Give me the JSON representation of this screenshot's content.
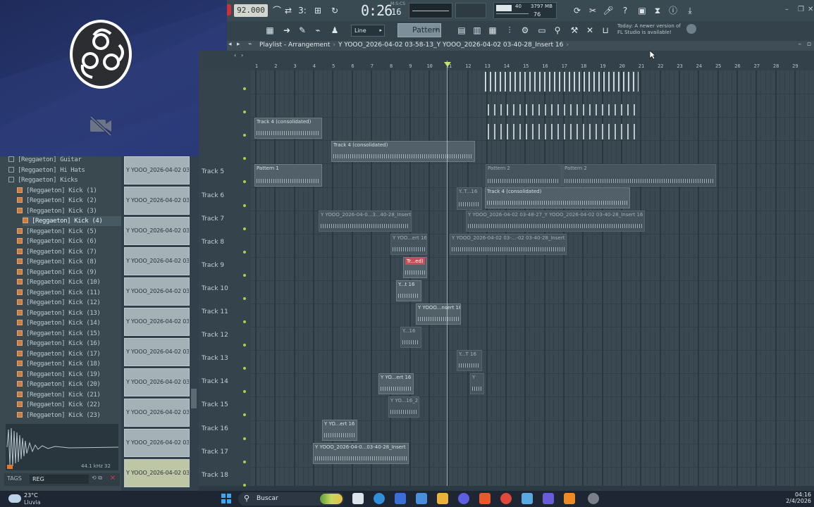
{
  "toolbar": {
    "tempo": "92.000",
    "time": "0:26",
    "time_frac": "16",
    "time_unit": "M:S:CS",
    "cpu_cores": "40",
    "memory": "3797 MB",
    "polyphony": "76",
    "snap_mode": "Line",
    "pattern": "Pattern 1",
    "news_line1": "Today: A newer version of",
    "news_line2": "FL Studio is available!"
  },
  "playlist": {
    "title": "Playlist - Arrangement",
    "path": "Y YOOO_2026-04-02 03-58-13_Y YOOO_2026-04-02 03-40-28_Insert 16",
    "ruler": [
      "1",
      "2",
      "3",
      "4",
      "5",
      "6",
      "7",
      "8",
      "9",
      "10",
      "11",
      "12",
      "13",
      "14",
      "15",
      "16",
      "17",
      "18",
      "19",
      "20",
      "21",
      "22",
      "23",
      "24",
      "25",
      "26",
      "27",
      "28",
      "29"
    ],
    "tracks": [
      "",
      "",
      "",
      "",
      "Track 5",
      "Track 6",
      "Track 7",
      "Track 8",
      "Track 9",
      "Track 10",
      "Track 11",
      "Track 12",
      "Track 13",
      "Track 14",
      "Track 15",
      "Track 16",
      "Track 17",
      "Track 18"
    ],
    "clips": {
      "c1": "Track 4 (consolidated)",
      "c2": "Track 4 (consolidated)",
      "c3": "Pattern 1",
      "c4": "Pattern 2",
      "c5": "Pattern 2",
      "c6": "Y..T...16",
      "c7": "Track 4 (consolidated)",
      "c8": "Y YOOO_2026-04-0...3...40-28_Insert 16",
      "c9": "Y YOOO_2026-04-02 03-48-27_Y YOOO_2026-04-02 03-40-28_Insert 16",
      "c10": "Y YOO...ert 16",
      "c11": "Y YOOO_2026-04-02 03-...-02 03-40-28_Insert 16",
      "c12": "Tr...ed)",
      "c13": "Y...t 16",
      "c14": "Y YOOO...nsert 16",
      "c15": "Y...16",
      "c16": "Y...T 16",
      "c17": "Y YO...ert 16",
      "c18": "Y",
      "c19": "Y YO...16_2",
      "c20": "Y YO...ert 16",
      "c21": "Y YOOO_2026-04-0...03-40-28_Insert 16"
    }
  },
  "browser": {
    "items": [
      {
        "label": "[Reggaeton] Guitar",
        "type": "folder"
      },
      {
        "label": "[Reggaeton] Hi Hats",
        "type": "folder"
      },
      {
        "label": "[Reggaeton] Kicks",
        "type": "folder-open"
      },
      {
        "label": "[Reggaeton] Kick (1)",
        "type": "file"
      },
      {
        "label": "[Reggaeton] Kick (2)",
        "type": "file"
      },
      {
        "label": "[Reggaeton] Kick (3)",
        "type": "file"
      },
      {
        "label": "[Reggaeton] Kick (4)",
        "type": "file",
        "selected": true
      },
      {
        "label": "[Reggaeton] Kick (5)",
        "type": "file"
      },
      {
        "label": "[Reggaeton] Kick (6)",
        "type": "file"
      },
      {
        "label": "[Reggaeton] Kick (7)",
        "type": "file"
      },
      {
        "label": "[Reggaeton] Kick (8)",
        "type": "file"
      },
      {
        "label": "[Reggaeton] Kick (9)",
        "type": "file"
      },
      {
        "label": "[Reggaeton] Kick (10)",
        "type": "file"
      },
      {
        "label": "[Reggaeton] Kick (11)",
        "type": "file"
      },
      {
        "label": "[Reggaeton] Kick (12)",
        "type": "file"
      },
      {
        "label": "[Reggaeton] Kick (13)",
        "type": "file"
      },
      {
        "label": "[Reggaeton] Kick (14)",
        "type": "file"
      },
      {
        "label": "[Reggaeton] Kick (15)",
        "type": "file"
      },
      {
        "label": "[Reggaeton] Kick (16)",
        "type": "file"
      },
      {
        "label": "[Reggaeton] Kick (17)",
        "type": "file"
      },
      {
        "label": "[Reggaeton] Kick (18)",
        "type": "file"
      },
      {
        "label": "[Reggaeton] Kick (19)",
        "type": "file"
      },
      {
        "label": "[Reggaeton] Kick (20)",
        "type": "file"
      },
      {
        "label": "[Reggaeton] Kick (21)",
        "type": "file"
      },
      {
        "label": "[Reggaeton] Kick (22)",
        "type": "file"
      },
      {
        "label": "[Reggaeton] Kick (23)",
        "type": "file"
      }
    ],
    "sample_rate": "44.1 kHz 32",
    "tags_label": "TAGS",
    "tags_value": "REG"
  },
  "picker": {
    "clips": [
      "Y YOOO_2026-04-02 03-...",
      "Y YOOO_2026-04-02 03-...",
      "Y YOOO_2026-04-02 03-...",
      "Y YOOO_2026-04-02 03-...",
      "Y YOOO_2026-04-02 03-...",
      "Y YOOO_2026-04-02 03-...",
      "Y YOOO_2026-04-02 03-...",
      "Y YOOO_2026-04-02 03-...",
      "Y YOOO_2026-04-02 03-...",
      "Y YOOO_2026-04-02 03-...",
      "Y YOOO_2026-04-02 03-..."
    ]
  },
  "taskbar": {
    "temperature": "23°C",
    "weather": "Lluvia",
    "search_placeholder": "Buscar",
    "time": "04:16",
    "date": "2/4/2026"
  },
  "colors": {
    "accent_green": "#a4d24a",
    "clip_red": "#c64f57",
    "record_red": "#c9323a",
    "obs_blue": "#25356d"
  }
}
